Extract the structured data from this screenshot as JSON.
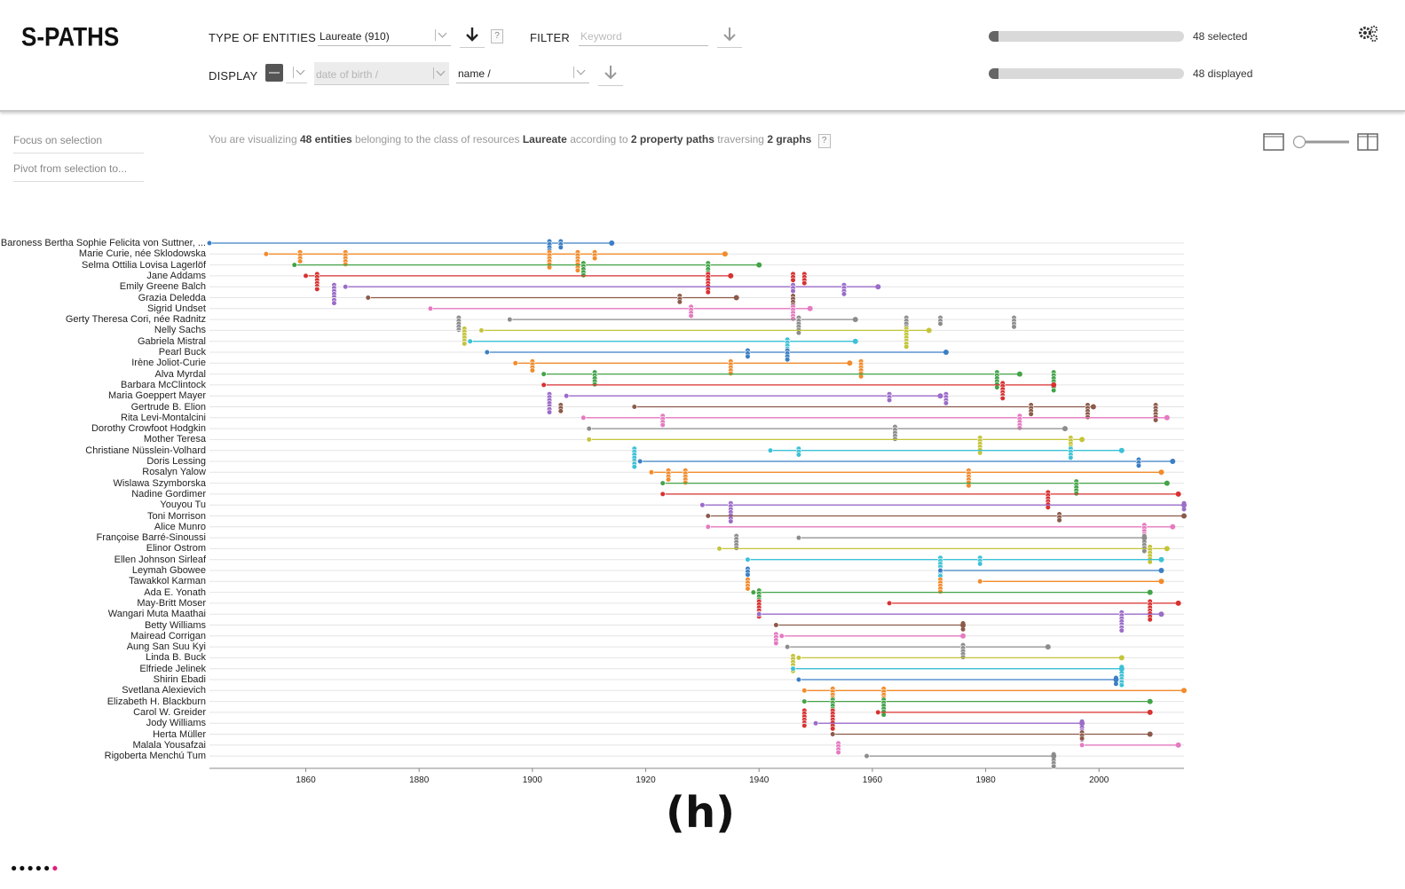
{
  "app": {
    "logo": "S-PATHS"
  },
  "toolbar": {
    "type_label": "TYPE OF ENTITIES",
    "type_value": "Laureate (910)",
    "filter_label": "FILTER",
    "filter_placeholder": "Keyword",
    "display_label": "DISPLAY",
    "display_x_placeholder": "date of birth /",
    "display_y_value": "name /",
    "help": "?"
  },
  "status": {
    "selected_label": "48 selected",
    "displayed_label": "48 displayed",
    "selected_fraction": 0.05,
    "displayed_fraction": 0.05
  },
  "side_menu": {
    "focus": "Focus on selection",
    "pivot": "Pivot from selection to..."
  },
  "info": {
    "prefix": "You are visualizing",
    "count": "48 entities",
    "mid1": "belonging to the class of resources",
    "class": "Laureate",
    "mid2": "according to",
    "paths": "2 property paths",
    "mid3": "traversing",
    "graphs": "2 graphs",
    "help": "?"
  },
  "chart_data": {
    "type": "scatter",
    "xlim": [
      1843,
      2015
    ],
    "xticks": [
      1860,
      1880,
      1900,
      1920,
      1940,
      1960,
      1980,
      2000
    ],
    "palette": [
      "#3b7fc4",
      "#f28b2b",
      "#43a347",
      "#d93131",
      "#9b6cc8",
      "#8c5a4a",
      "#e57ac0",
      "#8c8c8c",
      "#c4c43a",
      "#3cc1d6"
    ],
    "laureates": [
      {
        "name": "Baroness Bertha Sophie Felicita von Suttner, ...",
        "birth": 1843,
        "end": 1914,
        "events": [
          1905,
          1903
        ]
      },
      {
        "name": "Marie Curie, née Sklodowska",
        "birth": 1853,
        "end": 1934,
        "events": [
          1859,
          1867,
          1903,
          1908,
          1911
        ]
      },
      {
        "name": "Selma Ottilia Lovisa Lagerlöf",
        "birth": 1858,
        "end": 1940,
        "events": [
          1909,
          1931
        ]
      },
      {
        "name": "Jane Addams",
        "birth": 1860,
        "end": 1935,
        "events": [
          1862,
          1931,
          1946,
          1948
        ]
      },
      {
        "name": "Emily Greene Balch",
        "birth": 1867,
        "end": 1961,
        "events": [
          1865,
          1946,
          1955
        ]
      },
      {
        "name": "Grazia Deledda",
        "birth": 1871,
        "end": 1936,
        "events": [
          1926,
          1946
        ]
      },
      {
        "name": "Sigrid Undset",
        "birth": 1882,
        "end": 1949,
        "events": [
          1928,
          1946
        ]
      },
      {
        "name": "Gerty Theresa Cori, née Radnitz",
        "birth": 1896,
        "end": 1957,
        "events": [
          1887,
          1947,
          1966,
          1972,
          1985
        ]
      },
      {
        "name": "Nelly Sachs",
        "birth": 1891,
        "end": 1970,
        "events": [
          1888,
          1966
        ]
      },
      {
        "name": "Gabriela Mistral",
        "birth": 1889,
        "end": 1957,
        "events": [
          1945
        ]
      },
      {
        "name": "Pearl Buck",
        "birth": 1892,
        "end": 1973,
        "events": [
          1938,
          1945
        ]
      },
      {
        "name": "Irène Joliot-Curie",
        "birth": 1897,
        "end": 1956,
        "events": [
          1900,
          1935,
          1958
        ]
      },
      {
        "name": "Alva Myrdal",
        "birth": 1902,
        "end": 1986,
        "events": [
          1911,
          1982,
          1992
        ]
      },
      {
        "name": "Barbara McClintock",
        "birth": 1902,
        "end": 1992,
        "events": [
          1983
        ]
      },
      {
        "name": "Maria Goeppert Mayer",
        "birth": 1906,
        "end": 1972,
        "events": [
          1903,
          1963,
          1973
        ]
      },
      {
        "name": "Gertrude B. Elion",
        "birth": 1918,
        "end": 1999,
        "events": [
          1905,
          1988,
          1998,
          2010
        ]
      },
      {
        "name": "Rita Levi-Montalcini",
        "birth": 1909,
        "end": 2012,
        "events": [
          1923,
          1986
        ]
      },
      {
        "name": "Dorothy Crowfoot Hodgkin",
        "birth": 1910,
        "end": 1994,
        "events": [
          1964
        ]
      },
      {
        "name": "Mother Teresa",
        "birth": 1910,
        "end": 1997,
        "events": [
          1979,
          1995
        ]
      },
      {
        "name": "Christiane Nüsslein-Volhard",
        "birth": 1942,
        "end": 2004,
        "events": [
          1918,
          1947,
          1995
        ]
      },
      {
        "name": "Doris Lessing",
        "birth": 1919,
        "end": 2013,
        "events": [
          2007
        ]
      },
      {
        "name": "Rosalyn Yalow",
        "birth": 1921,
        "end": 2011,
        "events": [
          1924,
          1927,
          1977
        ]
      },
      {
        "name": "Wislawa Szymborska",
        "birth": 1923,
        "end": 2012,
        "events": [
          1996
        ]
      },
      {
        "name": "Nadine Gordimer",
        "birth": 1923,
        "end": 2014,
        "events": [
          1991
        ]
      },
      {
        "name": "Youyou Tu",
        "birth": 1930,
        "end": 2015,
        "events": [
          1935,
          2015
        ]
      },
      {
        "name": "Toni Morrison",
        "birth": 1931,
        "end": 2015,
        "events": [
          1993
        ]
      },
      {
        "name": "Alice Munro",
        "birth": 1931,
        "end": 2013,
        "events": [
          2008
        ]
      },
      {
        "name": "Françoise Barré-Sinoussi",
        "birth": 1947,
        "end": 2008,
        "events": [
          1936,
          2008
        ]
      },
      {
        "name": "Elinor Ostrom",
        "birth": 1933,
        "end": 2012,
        "events": [
          2009
        ]
      },
      {
        "name": "Ellen Johnson Sirleaf",
        "birth": 1938,
        "end": 2011,
        "events": [
          1972,
          1979
        ]
      },
      {
        "name": "Leymah Gbowee",
        "birth": 1972,
        "end": 2011,
        "events": [
          1938
        ]
      },
      {
        "name": "Tawakkol Karman",
        "birth": 1979,
        "end": 2011,
        "events": [
          1938,
          1972
        ]
      },
      {
        "name": "Ada E. Yonath",
        "birth": 1939,
        "end": 2009,
        "events": [
          1940
        ]
      },
      {
        "name": "May-Britt Moser",
        "birth": 1963,
        "end": 2014,
        "events": [
          1940,
          2009
        ]
      },
      {
        "name": "Wangari Muta Maathai",
        "birth": 1940,
        "end": 2011,
        "events": [
          2004
        ]
      },
      {
        "name": "Betty Williams",
        "birth": 1943,
        "end": 1976,
        "events": [
          1976
        ]
      },
      {
        "name": "Mairead Corrigan",
        "birth": 1944,
        "end": 1976,
        "events": [
          1943
        ]
      },
      {
        "name": "Aung San Suu Kyi",
        "birth": 1945,
        "end": 1991,
        "events": [
          1976
        ]
      },
      {
        "name": "Linda B. Buck",
        "birth": 1947,
        "end": 2004,
        "events": [
          1946
        ]
      },
      {
        "name": "Elfriede Jelinek",
        "birth": 1946,
        "end": 2004,
        "events": [
          2004
        ]
      },
      {
        "name": "Shirin Ebadi",
        "birth": 1947,
        "end": 2003,
        "events": [
          2003
        ]
      },
      {
        "name": "Svetlana Alexievich",
        "birth": 1948,
        "end": 2015,
        "events": [
          1953,
          1962
        ]
      },
      {
        "name": "Elizabeth H. Blackburn",
        "birth": 1948,
        "end": 2009,
        "events": [
          1953,
          1962
        ]
      },
      {
        "name": "Carol W. Greider",
        "birth": 1961,
        "end": 2009,
        "events": [
          1948,
          1953
        ]
      },
      {
        "name": "Jody Williams",
        "birth": 1950,
        "end": 1997,
        "events": [
          1997
        ]
      },
      {
        "name": "Herta Müller",
        "birth": 1953,
        "end": 2009,
        "events": [
          1997
        ]
      },
      {
        "name": "Malala Yousafzai",
        "birth": 1997,
        "end": 2014,
        "events": [
          1954
        ]
      },
      {
        "name": "Rigoberta Menchú Tum",
        "birth": 1959,
        "end": 1992,
        "events": [
          1992
        ]
      }
    ]
  },
  "figure_label": "(h)"
}
